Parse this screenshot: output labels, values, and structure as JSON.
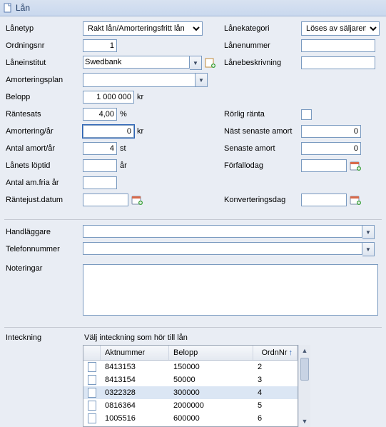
{
  "title": "Lån",
  "labels": {
    "lanetyp": "Lånetyp",
    "ordningsnr": "Ordningsnr",
    "laneinstitut": "Låneinstitut",
    "amorteringsplan": "Amorteringsplan",
    "belopp": "Belopp",
    "rantesats": "Räntesats",
    "amortering_ar": "Amortering/år",
    "antal_amort_ar": "Antal amort/år",
    "lanets_loptid": "Lånets löptid",
    "antal_amfria_ar": "Antal am.fria år",
    "rantejust_datum": "Räntejust.datum",
    "lanekategori": "Lånekategori",
    "lanenummer": "Lånenummer",
    "lanebeskrivning": "Lånebeskrivning",
    "rorlig_ranta": "Rörlig ränta",
    "nast_senaste_amort": "Näst senaste amort",
    "senaste_amort": "Senaste amort",
    "forfallodag": "Förfallodag",
    "konverteringsdag": "Konverteringsdag",
    "handlaggare": "Handläggare",
    "telefonnummer": "Telefonnummer",
    "noteringar": "Noteringar",
    "inteckning": "Inteckning",
    "inteckning_hint": "Välj inteckning som hör till lån"
  },
  "units": {
    "kr": "kr",
    "percent": "%",
    "st": "st",
    "ar": "år"
  },
  "values": {
    "lanetyp": "Rakt lån/Amorteringsfritt lån",
    "ordningsnr": "1",
    "laneinstitut": "Swedbank",
    "amorteringsplan": "",
    "belopp": "1 000 000",
    "rantesats": "4,00",
    "amortering_ar": "0",
    "antal_amort_ar": "4",
    "lanets_loptid": "",
    "antal_amfria_ar": "",
    "rantejust_datum": "",
    "lanekategori": "Löses av säljaren",
    "lanenummer": "",
    "lanebeskrivning": "",
    "nast_senaste_amort": "0",
    "senaste_amort": "0",
    "forfallodag": "",
    "konverteringsdag": "",
    "handlaggare": "",
    "telefonnummer": "",
    "noteringar": ""
  },
  "grid": {
    "headers": {
      "aktnummer": "Aktnummer",
      "belopp": "Belopp",
      "ordnnr": "OrdnNr"
    },
    "rows": [
      {
        "akt": "8413153",
        "belopp": "150000",
        "ordn": "2"
      },
      {
        "akt": "8413154",
        "belopp": "50000",
        "ordn": "3"
      },
      {
        "akt": "0322328",
        "belopp": "300000",
        "ordn": "4"
      },
      {
        "akt": "0816364",
        "belopp": "2000000",
        "ordn": "5"
      },
      {
        "akt": "1005516",
        "belopp": "600000",
        "ordn": "6"
      }
    ],
    "selected_index": 2
  }
}
